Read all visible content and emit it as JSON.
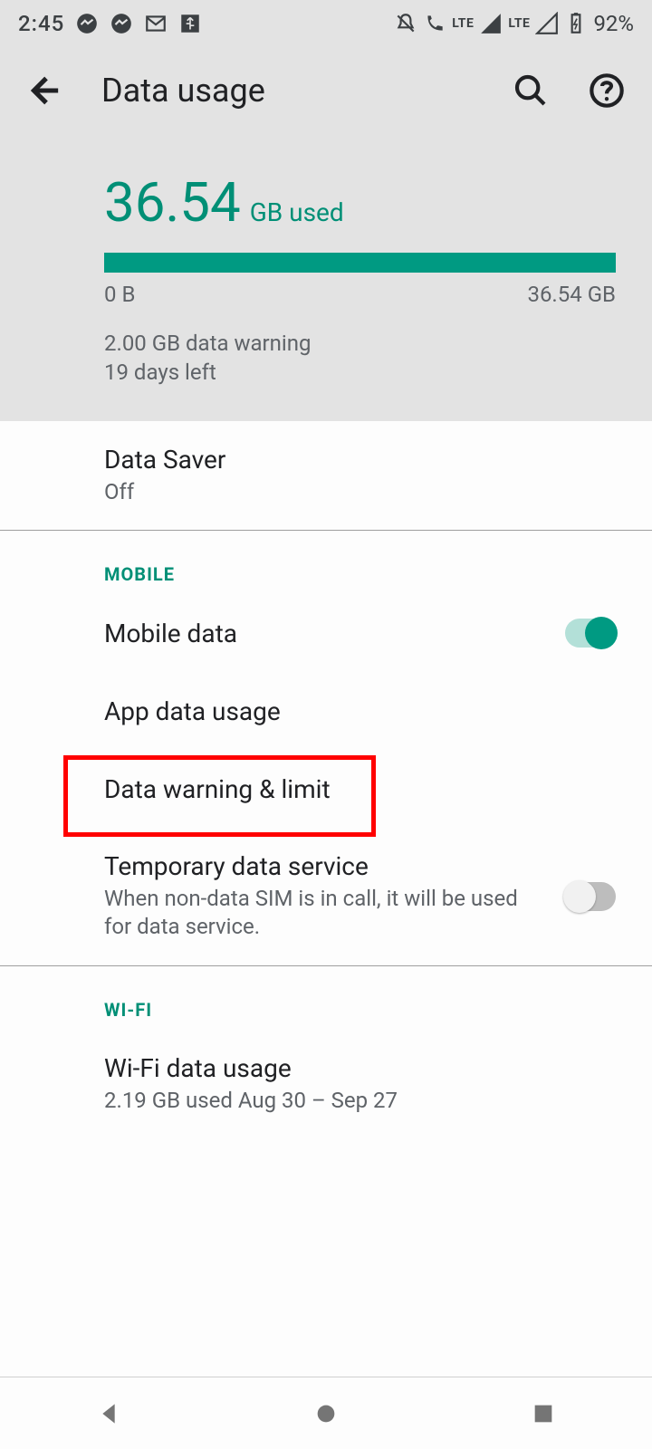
{
  "status": {
    "time": "2:45",
    "battery_text": "92%",
    "icons_left": [
      "messenger",
      "messenger",
      "gmail",
      "usb"
    ],
    "icons_right": [
      "dnd-off",
      "call-lte",
      "signal-full",
      "lte",
      "signal-empty",
      "battery-charging"
    ]
  },
  "appbar": {
    "title": "Data usage"
  },
  "summary": {
    "amount": "36.54",
    "unit": "GB used",
    "bar_min": "0 B",
    "bar_max": "36.54 GB",
    "warning_line": "2.00 GB data warning",
    "days_left": "19 days left"
  },
  "colors": {
    "accent": "#009a82",
    "accent_text": "#008f76"
  },
  "rows": {
    "data_saver": {
      "title": "Data Saver",
      "sub": "Off"
    },
    "section_mobile": "MOBILE",
    "mobile_data": {
      "title": "Mobile data",
      "switch": "on"
    },
    "app_data_usage": {
      "title": "App data usage"
    },
    "data_warning_limit": {
      "title": "Data warning & limit"
    },
    "temporary_data": {
      "title": "Temporary data service",
      "sub": "When non-data SIM is in call, it will be used for data service.",
      "switch": "off"
    },
    "section_wifi": "WI-FI",
    "wifi_data_usage": {
      "title": "Wi-Fi data usage",
      "sub": "2.19 GB used Aug 30 – Sep 27"
    }
  },
  "highlight": {
    "target": "data_warning_limit"
  }
}
